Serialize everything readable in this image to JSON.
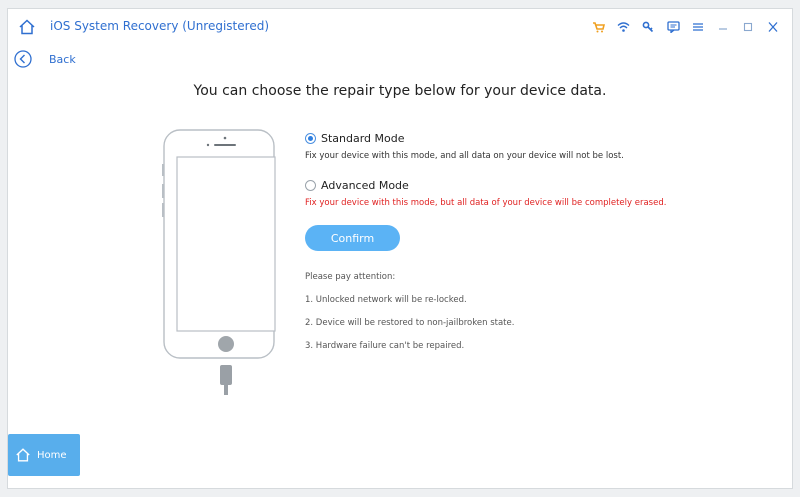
{
  "window": {
    "title": "iOS System Recovery (Unregistered)"
  },
  "titlebar_icons": [
    "cart-icon",
    "wifi-icon",
    "key-icon",
    "chat-icon",
    "menu-icon",
    "minimize-icon",
    "maximize-icon",
    "close-icon"
  ],
  "nav": {
    "back_label": "Back"
  },
  "main": {
    "heading": "You can choose the repair type below for your device data.",
    "options": [
      {
        "label": "Standard Mode",
        "selected": true,
        "description": "Fix your device with this mode, and all data on your device will not be lost."
      },
      {
        "label": "Advanced Mode",
        "selected": false,
        "description": "Fix your device with this mode, but all data of your device will be completely erased."
      }
    ],
    "confirm_label": "Confirm",
    "notes": {
      "title": "Please pay attention:",
      "items": [
        "1. Unlocked network will be re-locked.",
        "2. Device will be restored to non-jailbroken state.",
        "3. Hardware failure can't be repaired."
      ]
    }
  },
  "footer": {
    "home_label": "Home"
  },
  "colors": {
    "accent": "#2f6fd0",
    "button": "#5bb3f5",
    "warning": "#e02222",
    "cart": "#f0a020"
  }
}
